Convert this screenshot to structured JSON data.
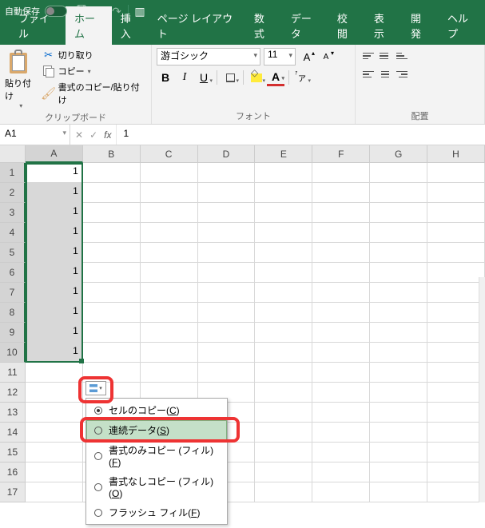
{
  "titlebar": {
    "autosave_label": "自動保存",
    "autosave_state": "オフ"
  },
  "qat": {
    "save": "save-icon",
    "undo": "undo-icon",
    "redo": "redo-icon",
    "mode": "touch-mode-icon"
  },
  "tabs": [
    "ファイル",
    "ホーム",
    "挿入",
    "ページ レイアウト",
    "数式",
    "データ",
    "校閲",
    "表示",
    "開発",
    "ヘルプ"
  ],
  "active_tab_index": 1,
  "ribbon": {
    "clipboard": {
      "paste": "貼り付け",
      "cut": "切り取り",
      "copy": "コピー",
      "format_painter": "書式のコピー/貼り付け",
      "group_label": "クリップボード"
    },
    "font": {
      "name": "游ゴシック",
      "size": "11",
      "bold": "B",
      "italic": "I",
      "underline": "U",
      "grow": "A",
      "shrink": "A",
      "color_letter": "A",
      "group_label": "フォント"
    },
    "align": {
      "group_label": "配置"
    }
  },
  "formula_bar": {
    "cell_ref": "A1",
    "value": "1"
  },
  "grid": {
    "columns": [
      "A",
      "B",
      "C",
      "D",
      "E",
      "F",
      "G",
      "H"
    ],
    "selected_col_index": 0,
    "rows": 17,
    "selected_rows": [
      1,
      2,
      3,
      4,
      5,
      6,
      7,
      8,
      9,
      10
    ],
    "fill_values": {
      "1": "1",
      "2": "1",
      "3": "1",
      "4": "1",
      "5": "1",
      "6": "1",
      "7": "1",
      "8": "1",
      "9": "1",
      "10": "1"
    }
  },
  "autofill_menu": {
    "items": [
      {
        "label_pre": "セルのコピー(",
        "key": "C",
        "label_post": ")",
        "checked": true
      },
      {
        "label_pre": "連続データ(",
        "key": "S",
        "label_post": ")",
        "checked": false,
        "hover": true
      },
      {
        "label_pre": "書式のみコピー (フィル)(",
        "key": "F",
        "label_post": ")",
        "checked": false
      },
      {
        "label_pre": "書式なしコピー (フィル)(",
        "key": "O",
        "label_post": ")",
        "checked": false
      },
      {
        "label_pre": "フラッシュ フィル(",
        "key": "F",
        "label_post": ")",
        "checked": false
      }
    ]
  }
}
